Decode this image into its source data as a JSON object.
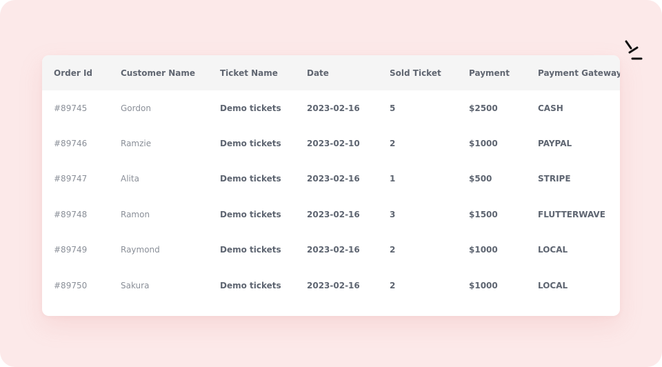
{
  "table": {
    "headers": {
      "order_id": "Order Id",
      "customer_name": "Customer Name",
      "ticket_name": "Ticket Name",
      "date": "Date",
      "sold_ticket": "Sold Ticket",
      "payment": "Payment",
      "payment_gateway": "Payment Gateway"
    },
    "rows": [
      {
        "order_id": "#89745",
        "customer_name": "Gordon",
        "ticket_name": "Demo tickets",
        "date": "2023-02-16",
        "sold_ticket": "5",
        "payment": "$2500",
        "payment_gateway": "CASH"
      },
      {
        "order_id": "#89746",
        "customer_name": "Ramzie",
        "ticket_name": "Demo tickets",
        "date": "2023-02-10",
        "sold_ticket": "2",
        "payment": "$1000",
        "payment_gateway": "PAYPAL"
      },
      {
        "order_id": "#89747",
        "customer_name": "Alita",
        "ticket_name": "Demo tickets",
        "date": "2023-02-16",
        "sold_ticket": "1",
        "payment": "$500",
        "payment_gateway": "STRIPE"
      },
      {
        "order_id": "#89748",
        "customer_name": "Ramon",
        "ticket_name": "Demo tickets",
        "date": "2023-02-16",
        "sold_ticket": "3",
        "payment": "$1500",
        "payment_gateway": "FLUTTERWAVE"
      },
      {
        "order_id": "#89749",
        "customer_name": "Raymond",
        "ticket_name": "Demo tickets",
        "date": "2023-02-16",
        "sold_ticket": "2",
        "payment": "$1000",
        "payment_gateway": "LOCAL"
      },
      {
        "order_id": "#89750",
        "customer_name": "Sakura",
        "ticket_name": "Demo tickets",
        "date": "2023-02-16",
        "sold_ticket": "2",
        "payment": "$1000",
        "payment_gateway": "LOCAL"
      }
    ]
  },
  "colors": {
    "background": "#fce9e9",
    "card": "#ffffff",
    "header_row": "#f5f5f5",
    "text_strong": "#5e6571",
    "text_muted": "#8a8f98",
    "sparkle": "#111111"
  },
  "icons": {
    "sparkle": "sparkle-icon"
  }
}
